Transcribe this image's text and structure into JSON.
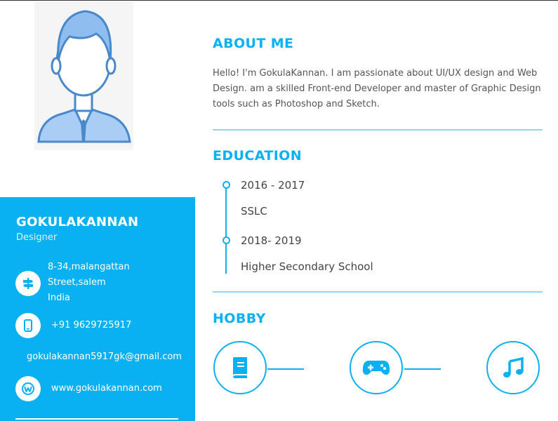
{
  "profile": {
    "name": "GOKULAKANNAN",
    "role": "Designer"
  },
  "contact": {
    "address_line1": "8-34,malangattan",
    "address_line2": "Street,salem",
    "address_line3": "India",
    "phone": "+91 9629725917",
    "email": "gokulakannan5917gk@gmail.com",
    "website": "www.gokulakannan.com"
  },
  "about": {
    "heading": "ABOUT ME",
    "text": "Hello! I'm GokulaKannan. I am passionate about UI/UX design and Web Design. am a skilled Front-end Developer and master of Graphic Design tools such as Photoshop and Sketch."
  },
  "education": {
    "heading": "EDUCATION",
    "items": [
      {
        "years": "2016 - 2017",
        "title": "SSLC"
      },
      {
        "years": "2018- 2019",
        "title": "Higher Secondary School"
      }
    ]
  },
  "hobby": {
    "heading": "HOBBY",
    "icons": [
      "book-icon",
      "gamepad-icon",
      "music-icon"
    ]
  },
  "colors": {
    "accent": "#0ab1f2",
    "divider": "#8fd6f4",
    "avatar_blue": "#5b9fe0"
  }
}
